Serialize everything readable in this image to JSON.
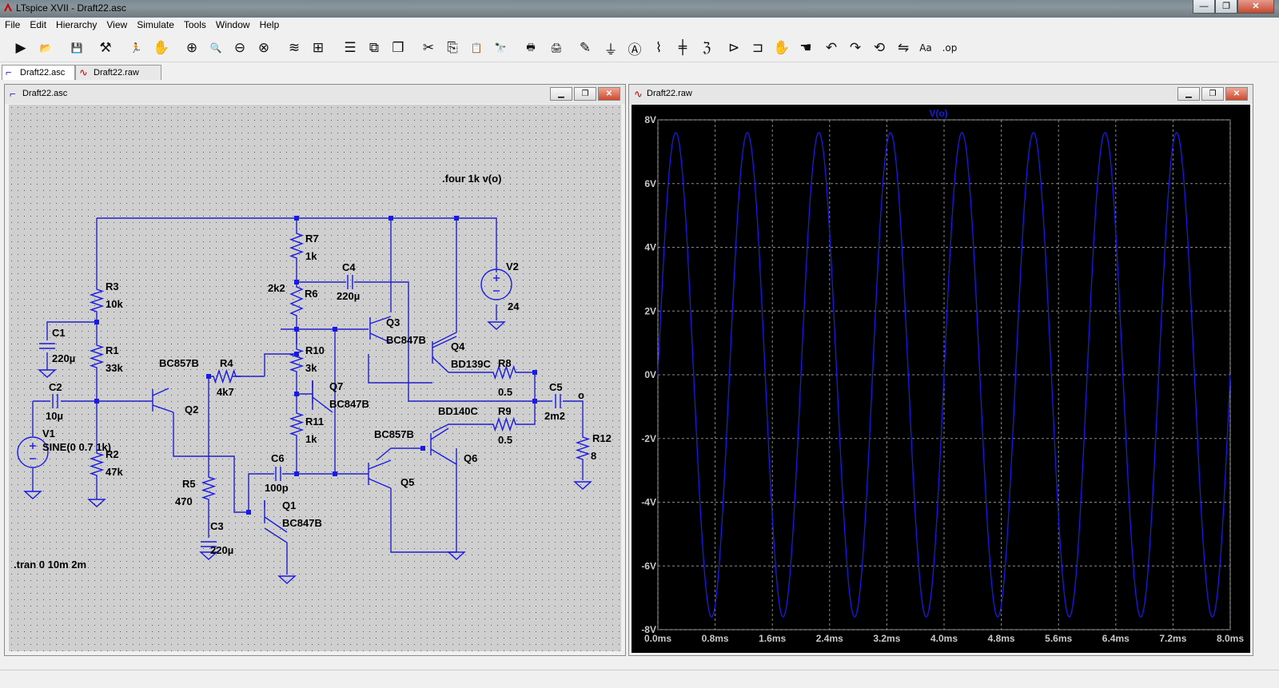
{
  "window": {
    "title": "LTspice XVII - Draft22.asc",
    "buttons": [
      "—",
      "❐",
      "✕"
    ]
  },
  "menu": [
    "File",
    "Edit",
    "Hierarchy",
    "View",
    "Simulate",
    "Tools",
    "Window",
    "Help"
  ],
  "toolbar": [
    {
      "name": "run-icon",
      "glyph": "▶"
    },
    {
      "name": "open-folder-icon",
      "glyph": "📂"
    },
    {
      "name": "save-icon",
      "glyph": "💾"
    },
    {
      "name": "control-panel-icon",
      "glyph": "⚒"
    },
    {
      "name": "run-man-icon",
      "glyph": "🏃"
    },
    {
      "name": "halt-hand-icon",
      "glyph": "✋"
    },
    {
      "name": "zoom-in-icon",
      "glyph": "⊕"
    },
    {
      "name": "zoom-pan-icon",
      "glyph": "🔍"
    },
    {
      "name": "zoom-out-icon",
      "glyph": "⊖"
    },
    {
      "name": "zoom-fit-icon",
      "glyph": "⊗"
    },
    {
      "name": "autorange-icon",
      "glyph": "≋"
    },
    {
      "name": "grid-icon",
      "glyph": "⊞"
    },
    {
      "name": "tile-horizontal-icon",
      "glyph": "☰"
    },
    {
      "name": "tile-vertical-icon",
      "glyph": "⧉"
    },
    {
      "name": "cascade-icon",
      "glyph": "❒"
    },
    {
      "name": "cut-icon",
      "glyph": "✂"
    },
    {
      "name": "copy-icon",
      "glyph": "⎘"
    },
    {
      "name": "paste-icon",
      "glyph": "📋"
    },
    {
      "name": "find-icon",
      "glyph": "🔭"
    },
    {
      "name": "print-icon",
      "glyph": "🖶"
    },
    {
      "name": "print-setup-icon",
      "glyph": "🖨"
    },
    {
      "name": "draw-wire-icon",
      "glyph": "✎"
    },
    {
      "name": "ground-icon",
      "glyph": "⏚"
    },
    {
      "name": "label-net-icon",
      "glyph": "Ⓐ"
    },
    {
      "name": "resistor-icon",
      "glyph": "⌇"
    },
    {
      "name": "capacitor-icon",
      "glyph": "╪"
    },
    {
      "name": "inductor-icon",
      "glyph": "ℨ"
    },
    {
      "name": "diode-icon",
      "glyph": "⊳"
    },
    {
      "name": "component-icon",
      "glyph": "⊐"
    },
    {
      "name": "move-hand-icon",
      "glyph": "✋"
    },
    {
      "name": "drag-hand-icon",
      "glyph": "☚"
    },
    {
      "name": "undo-icon",
      "glyph": "↶"
    },
    {
      "name": "redo-icon",
      "glyph": "↷"
    },
    {
      "name": "rotate-icon",
      "glyph": "⟲"
    },
    {
      "name": "mirror-icon",
      "glyph": "⇋"
    },
    {
      "name": "text-icon",
      "glyph": "Aa"
    },
    {
      "name": "spice-directive-icon",
      "glyph": ".op"
    }
  ],
  "tabs": [
    {
      "label": "Draft22.asc",
      "icon": "schematic-icon",
      "active": true
    },
    {
      "label": "Draft22.raw",
      "icon": "waveform-icon",
      "active": false
    }
  ],
  "schematic_window": {
    "title": "Draft22.asc",
    "components": {
      "R7": "R7",
      "R7v": "1k",
      "C4": "C4",
      "C4v": "220µ",
      "V2": "V2",
      "V2v": "24",
      "R6v": "2k2",
      "R6": "R6",
      "R3": "R3",
      "R3v": "10k",
      "C1": "C1",
      "C1v": "220µ",
      "R1": "R1",
      "R1v": "33k",
      "Q3": "Q3",
      "Q3t": "BC847B",
      "Q4": "Q4",
      "Q4t": "BD139C",
      "R10": "R10",
      "R10v": "3k",
      "R8": "R8",
      "R8v": "0.5",
      "Q2t": "BC857B",
      "R4": "R4",
      "R4v": "4k7",
      "Q7": "Q7",
      "Q7t": "BC847B",
      "C5": "C5",
      "C5v": "2m2",
      "out": "o",
      "C2": "C2",
      "C2v": "10µ",
      "Q2": "Q2",
      "R9": "R9",
      "R9v": "0.5",
      "Q6t": "BD140C",
      "R12": "R12",
      "R12v": "8",
      "V1": "V1",
      "V1v": "SINE(0 0.7 1k)",
      "R2": "R2",
      "R2v": "47k",
      "R11": "R11",
      "R11v": "1k",
      "Q5t": "BC857B",
      "Q6": "Q6",
      "C6": "C6",
      "C6v": "100p",
      "Q5": "Q5",
      "R5": "R5",
      "R5v": "470",
      "Q1": "Q1",
      "Q1t": "BC847B",
      "C3": "C3",
      "C3v": "220µ"
    },
    "directives": {
      "four": ".four 1k v(o)",
      "tran": ".tran 0 10m 2m"
    }
  },
  "waveform_window": {
    "title": "Draft22.raw",
    "trace_label": "V(o)",
    "trace_color": "#1a1ae6"
  },
  "chart_data": {
    "type": "line",
    "series": [
      {
        "name": "V(o)",
        "amplitude": 7.6,
        "frequency_hz": 1000,
        "phase_start_ms": 0
      }
    ],
    "x_range_ms": [
      0,
      8
    ],
    "ylim": [
      -8,
      8
    ],
    "xticks": [
      "0.0ms",
      "0.8ms",
      "1.6ms",
      "2.4ms",
      "3.2ms",
      "4.0ms",
      "4.8ms",
      "5.6ms",
      "6.4ms",
      "7.2ms",
      "8.0ms"
    ],
    "yticks": [
      "8V",
      "6V",
      "4V",
      "2V",
      "0V",
      "-2V",
      "-4V",
      "-6V",
      "-8V"
    ],
    "grid": true,
    "background": "#000000"
  }
}
